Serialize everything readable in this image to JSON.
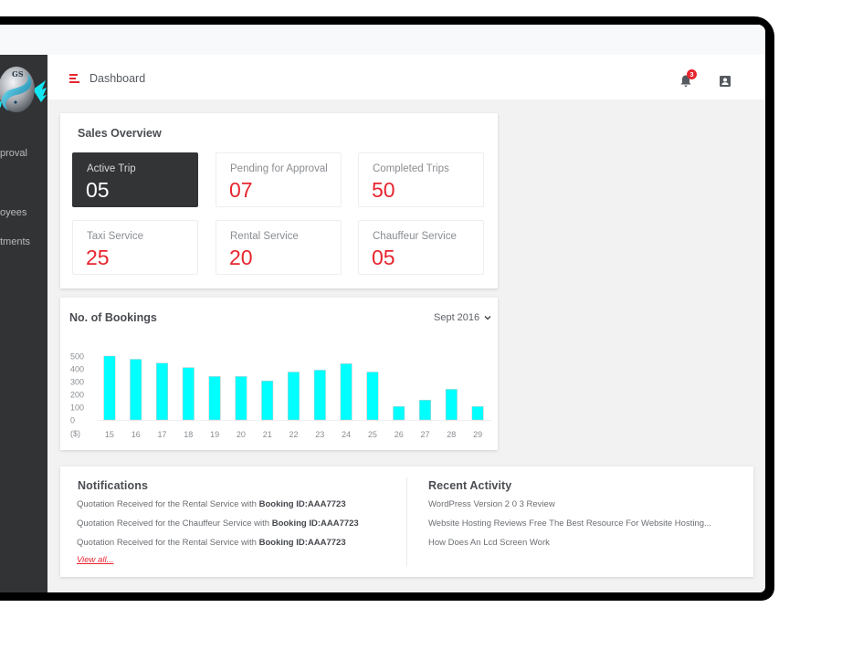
{
  "app": {
    "logo_text": "GS"
  },
  "sidebar": {
    "items": [
      {
        "label": "Pending for Approval",
        "visible_fragment": "proval"
      },
      {
        "label": "Employees",
        "visible_fragment": "oyees"
      },
      {
        "label": "Departments",
        "visible_fragment": "tments"
      }
    ]
  },
  "header": {
    "title": "Dashboard",
    "menu_icon": "hamburger-menu-icon",
    "notification_icon": "bell-icon",
    "notification_count": "3",
    "profile_icon": "account-box-icon"
  },
  "sales_overview": {
    "title": "Sales Overview",
    "stats": [
      {
        "label": "Active Trip",
        "value": "05",
        "active": true
      },
      {
        "label": "Pending for Approval",
        "value": "07",
        "active": false
      },
      {
        "label": "Completed Trips",
        "value": "50",
        "active": false
      },
      {
        "label": "Taxi Service",
        "value": "25",
        "active": false
      },
      {
        "label": "Rental Service",
        "value": "20",
        "active": false
      },
      {
        "label": "Chauffeur Service",
        "value": "05",
        "active": false
      }
    ]
  },
  "bookings": {
    "title": "No. of Bookings",
    "period_selected": "Sept 2016"
  },
  "chart_data": {
    "type": "bar",
    "title": "No. of Bookings",
    "xlabel": "",
    "ylabel": "($)",
    "categories": [
      "15",
      "16",
      "17",
      "18",
      "19",
      "20",
      "21",
      "22",
      "23",
      "24",
      "25",
      "26",
      "27",
      "28",
      "29"
    ],
    "values": [
      500,
      475,
      445,
      410,
      340,
      340,
      305,
      375,
      390,
      440,
      375,
      105,
      155,
      240,
      105
    ],
    "y_ticks": [
      0,
      100,
      200,
      300,
      400,
      500
    ],
    "ylim": [
      0,
      500
    ],
    "grid": false,
    "legend": "none",
    "bar_color": "#00ffff"
  },
  "notifications": {
    "title": "Notifications",
    "items": [
      {
        "text": "Quotation Received for the Rental Service with ",
        "bold": "Booking ID:AAA7723"
      },
      {
        "text": "Quotation Received for the Chauffeur Service with ",
        "bold": "Booking ID:AAA7723"
      },
      {
        "text": "Quotation Received for the Rental Service with ",
        "bold": "Booking ID:AAA7723"
      }
    ],
    "view_all_label": "View all..."
  },
  "recent_activity": {
    "title": "Recent Activity",
    "items": [
      "WordPress Version 2 0 3 Review",
      "Website Hosting Reviews Free The Best Resource For Website Hosting...",
      "How Does An Lcd Screen Work"
    ]
  },
  "colors": {
    "accent": "#e8252f",
    "sidebar_bg": "#323335",
    "active_card_bg": "#333436",
    "bar": "#00ffff",
    "page_bg": "#f2f2f2"
  }
}
